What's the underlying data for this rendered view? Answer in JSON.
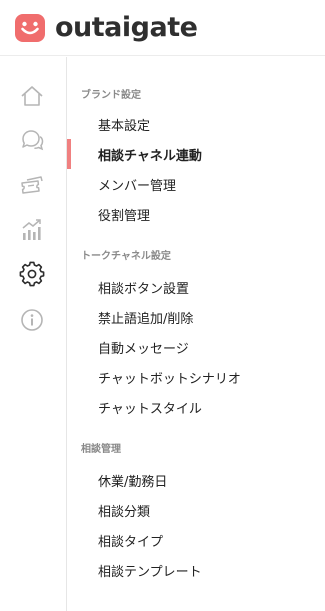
{
  "brand": {
    "name": "outaigate",
    "accent": "#f06d6d"
  },
  "rail": [
    {
      "icon": "home-icon"
    },
    {
      "icon": "chat-icon"
    },
    {
      "icon": "tickets-icon"
    },
    {
      "icon": "analytics-icon"
    },
    {
      "icon": "gear-icon",
      "active": true
    },
    {
      "icon": "info-icon"
    }
  ],
  "sections": [
    {
      "title": "ブランド設定",
      "items": [
        {
          "label": "基本設定"
        },
        {
          "label": "相談チャネル連動",
          "active": true
        },
        {
          "label": "メンバー管理"
        },
        {
          "label": "役割管理"
        }
      ]
    },
    {
      "title": "トークチャネル設定",
      "items": [
        {
          "label": "相談ボタン設置"
        },
        {
          "label": "禁止語追加/削除"
        },
        {
          "label": "自動メッセージ"
        },
        {
          "label": "チャットボットシナリオ"
        },
        {
          "label": "チャットスタイル"
        }
      ]
    },
    {
      "title": "相談管理",
      "items": [
        {
          "label": "休業/勤務日"
        },
        {
          "label": "相談分類"
        },
        {
          "label": "相談タイプ"
        },
        {
          "label": "相談テンプレート"
        }
      ]
    }
  ]
}
